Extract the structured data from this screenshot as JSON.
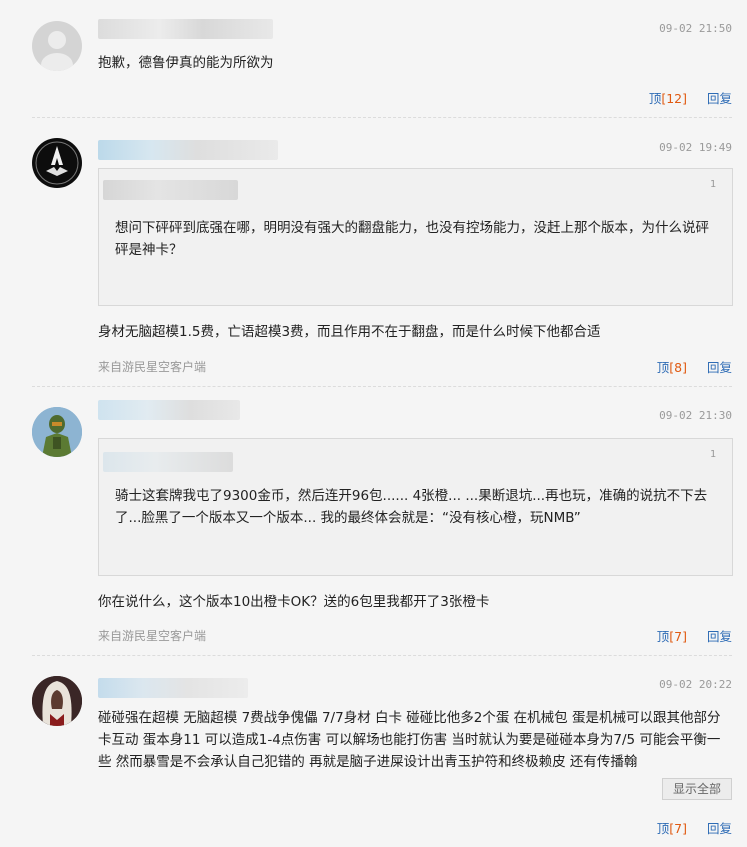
{
  "comments": [
    {
      "time": "09-02 21:50",
      "text": "抱歉，德鲁伊真的能为所欲为",
      "up_label": "顶",
      "up_count": "[12]",
      "reply_label": "回复"
    },
    {
      "time": "09-02 19:49",
      "quote_num": "1",
      "quote_text": "想问下砰砰到底强在哪，明明没有强大的翻盘能力，也没有控场能力，没赶上那个版本，为什么说砰砰是神卡？",
      "text": "身材无脑超模1.5费，亡语超模3费，而且作用不在于翻盘，而是什么时候下他都合适",
      "from": "来自游民星空客户端",
      "up_label": "顶",
      "up_count": "[8]",
      "reply_label": "回复"
    },
    {
      "time": "09-02 21:30",
      "quote_num": "1",
      "quote_text": "骑士这套牌我屯了9300金币，然后连开96包...... 4张橙... ...果断退坑...再也玩，准确的说抗不下去了...脸黑了一个版本又一个版本... 我的最终体会就是：“没有核心橙，玩NMB”",
      "text": "你在说什么，这个版本10出橙卡OK？送的6包里我都开了3张橙卡",
      "from": "来自游民星空客户端",
      "up_label": "顶",
      "up_count": "[7]",
      "reply_label": "回复"
    },
    {
      "time": "09-02 20:22",
      "text": "碰碰强在超模 无脑超模 7费战争傀儡 7/7身材 白卡 碰碰比他多2个蛋 在机械包 蛋是机械可以跟其他部分卡互动 蛋本身11 可以造成1-4点伤害 可以解场也能打伤害 当时就认为要是碰碰本身为7/5 可能会平衡一些 然而暴雪是不会承认自己犯错的 再就是脑子进屎设计出青玉护符和终极赖皮 还有传播翰",
      "show_all": "显示全部",
      "up_label": "顶",
      "up_count": "[7]",
      "reply_label": "回复"
    }
  ]
}
